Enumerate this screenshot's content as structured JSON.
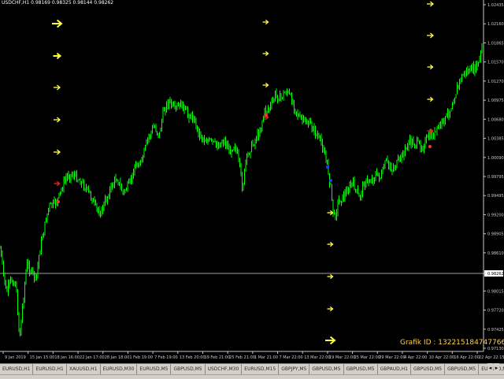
{
  "header": {
    "info_line": "USDCHF,H1  0.98169 0.98325 0.98144 0.98262"
  },
  "price_axis": {
    "labels": [
      "1.02435",
      "1.02160",
      "1.01865",
      "1.01570",
      "1.01270",
      "1.00975",
      "1.00680",
      "1.00385",
      "1.00090",
      "0.99795",
      "0.99495",
      "0.99200",
      "0.98905",
      "0.98610",
      "0.98262",
      "0.98015",
      "0.97720",
      "0.97425",
      "0.97130"
    ],
    "current_price": "0.98262"
  },
  "time_axis": {
    "labels": [
      "9 Jan 2019",
      "15 Jan 15:00",
      "18 Jan 16:00",
      "22 Jan 17:00",
      "28 Jan 18:00",
      "1 Feb 19:00",
      "7 Feb 19:00",
      "13 Feb 20:00",
      "19 Feb 21:00",
      "25 Feb 21:00",
      "1 Mar 21:00",
      "7 Mar 22:00",
      "13 Mar 22:00",
      "19 Mar 22:00",
      "25 Mar 22:00",
      "29 Mar 22:00",
      "4 Apr 22:00",
      "10 Apr 22:00",
      "16 Apr 22:00",
      "22 Apr 22:15"
    ]
  },
  "grafik_id": "Grafik ID : 13221518474776630​7",
  "tabs": [
    "EURUSD,H1",
    "EURUSD,H1",
    "XAUUSD,H1",
    "EURUSD,M30",
    "EURUSD,M5",
    "GBPUSD,M5",
    "USDCHF,M30",
    "EURUSD,M15",
    "GBPJPY,M5",
    "GBPUSD,M5",
    "GBPUSD,M5",
    "GBPAUD,H1",
    "GBPUSD,M5",
    "GBPUSD,M5",
    "EURUSD,M5",
    "EURJPY,M5",
    "EURUSD,M5",
    "USE"
  ],
  "active_tab": 17,
  "tab_nav": {
    "left": "◂",
    "right": "▸"
  },
  "colors": {
    "background": "#000000",
    "candles": "#00ff00",
    "arrow_yellow": "#ffff40",
    "arrow_red": "#ff2020",
    "arrow_blue": "#2040ff",
    "axis_text": "#c8c8c8",
    "price_line": "#a0a0a0"
  },
  "markers": {
    "yellow_arrow_icon": "right-arrow-icon",
    "red_arrow_icon": "right-arrow-icon",
    "blue_marker_icon": "dot-icon"
  }
}
